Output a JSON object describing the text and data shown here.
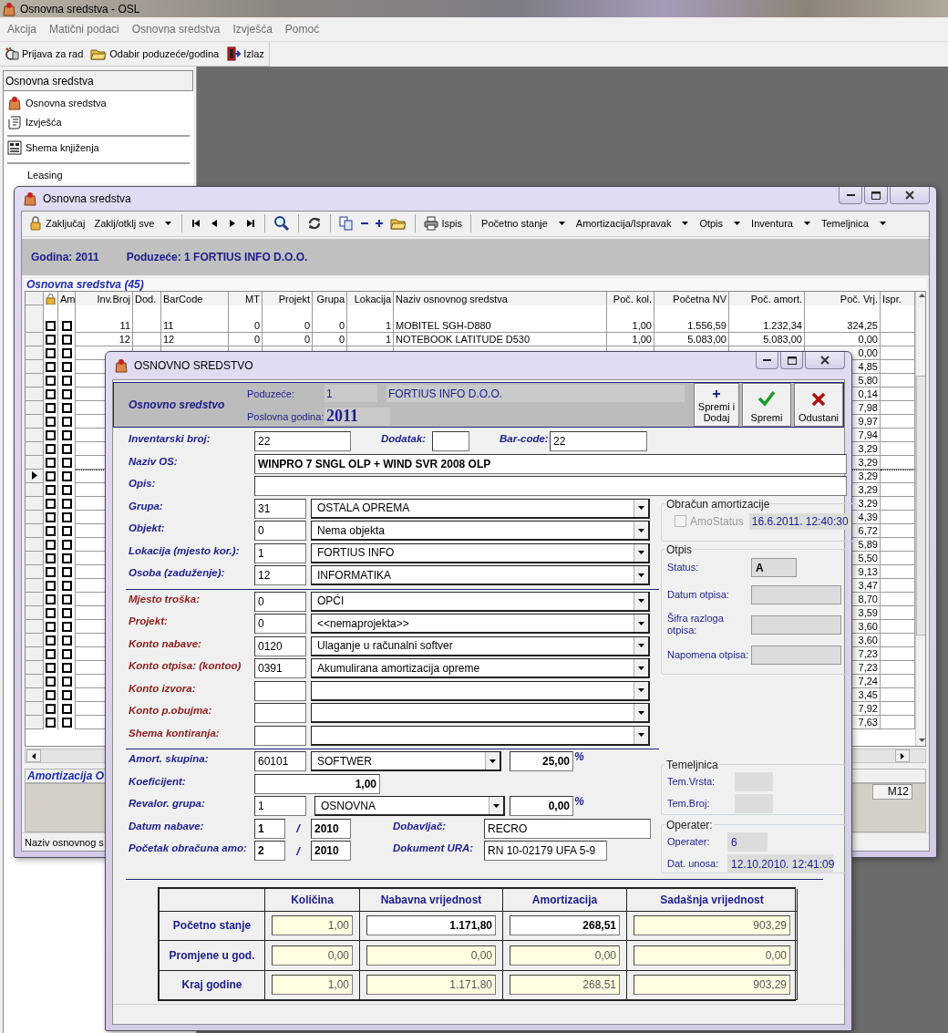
{
  "app": {
    "title": "Osnovna sredstva - OSL",
    "menu": [
      "Akcija",
      "Matični podaci",
      "Osnovna sredstva",
      "Izvješća",
      "Pomoć"
    ],
    "toolbar": [
      {
        "kind": "login",
        "label": "Prijava za rad"
      },
      {
        "kind": "folder",
        "label": "Odabir poduzeće/godina"
      },
      {
        "kind": "exit",
        "label": "Izlaz"
      }
    ]
  },
  "sidebar": {
    "header": "Osnovna sredstva",
    "items": [
      {
        "kind": "assets",
        "label": "Osnovna sredstva",
        "divider_above": false
      },
      {
        "kind": "reports",
        "label": "Izvješća",
        "divider_above": false
      },
      {
        "kind": "scheme",
        "label": "Shema knjiženja",
        "divider_above": true
      },
      {
        "kind": "plain",
        "label": "Leasing",
        "divider_above": true
      }
    ]
  },
  "list_window": {
    "title": "Osnovna sredstva",
    "toolbar": [
      {
        "kind": "lock",
        "label": "Zaključaj"
      },
      {
        "kind": "dropdown",
        "label": "Zaklj/otklj sve"
      },
      {
        "kind": "separator"
      },
      {
        "kind": "first"
      },
      {
        "kind": "prev"
      },
      {
        "kind": "next"
      },
      {
        "kind": "last"
      },
      {
        "kind": "separator"
      },
      {
        "kind": "search"
      },
      {
        "kind": "separator"
      },
      {
        "kind": "refresh"
      },
      {
        "kind": "separator"
      },
      {
        "kind": "copy"
      },
      {
        "kind": "minus"
      },
      {
        "kind": "plus"
      },
      {
        "kind": "folder"
      },
      {
        "kind": "separator"
      },
      {
        "kind": "print",
        "label": "Ispis"
      },
      {
        "kind": "separator"
      },
      {
        "kind": "dropdown",
        "label": "Početno stanje"
      },
      {
        "kind": "dropdown",
        "label": "Amortizacija/Ispravak"
      },
      {
        "kind": "dropdown",
        "label": "Otpis"
      },
      {
        "kind": "dropdown",
        "label": "Inventura"
      },
      {
        "kind": "dropdown",
        "label": "Temeljnica"
      }
    ],
    "year": "Godina: 2011",
    "company": "Poduzeće: 1 FORTIUS INFO D.O.O.",
    "grid": {
      "caption": "Osnovna sredstva (45)",
      "columns": [
        {
          "kind": "lock"
        },
        {
          "kind": "text",
          "label": "Am"
        },
        {
          "kind": "text",
          "label": "Inv.Broj"
        },
        {
          "kind": "text",
          "label": "Dod."
        },
        {
          "kind": "text",
          "label": "BarCode"
        },
        {
          "kind": "text",
          "label": "MT"
        },
        {
          "kind": "text",
          "label": "Projekt"
        },
        {
          "kind": "text",
          "label": "Grupa"
        },
        {
          "kind": "text",
          "label": "Lokacija"
        },
        {
          "kind": "text",
          "label": "Naziv osnovnog sredstva"
        },
        {
          "kind": "text",
          "label": "Poč. kol."
        },
        {
          "kind": "text",
          "label": "Početna NV"
        },
        {
          "kind": "text",
          "label": "Poč. amort."
        },
        {
          "kind": "text",
          "label": "Poč. Vrj."
        },
        {
          "kind": "text",
          "label": "Ispr."
        }
      ],
      "rows": [
        {
          "current": false,
          "locked": false,
          "am": false,
          "cells": {
            "inv": "11",
            "bar": "11",
            "mt": "0",
            "proj": "0",
            "grp": "0",
            "lok": "1",
            "naziv": "MOBITEL SGH-D880",
            "kol": "1,00",
            "nv": "1.556,59",
            "amort": "1.232,34",
            "vrj": "324,25"
          }
        },
        {
          "current": false,
          "locked": false,
          "am": false,
          "cells": {
            "inv": "12",
            "bar": "12",
            "mt": "0",
            "proj": "0",
            "grp": "0",
            "lok": "1",
            "naziv": "NOTEBOOK LATITUDE D530",
            "kol": "1,00",
            "nv": "5.083,00",
            "amort": "5.083,00",
            "vrj": "0,00"
          }
        },
        {
          "current": false,
          "locked": false,
          "am": false,
          "cells": {
            "vrj": "0,00"
          }
        },
        {
          "current": false,
          "locked": false,
          "am": false,
          "cells": {
            "vrj": "4,85"
          }
        },
        {
          "current": false,
          "locked": false,
          "am": false,
          "cells": {
            "vrj": "5,80"
          }
        },
        {
          "current": false,
          "locked": false,
          "am": false,
          "cells": {
            "vrj": "0,14"
          }
        },
        {
          "current": false,
          "locked": false,
          "am": false,
          "cells": {
            "vrj": "7,98"
          }
        },
        {
          "current": false,
          "locked": false,
          "am": false,
          "cells": {
            "vrj": "9,97"
          }
        },
        {
          "current": false,
          "locked": false,
          "am": false,
          "cells": {
            "vrj": "7,94"
          }
        },
        {
          "current": false,
          "locked": false,
          "am": false,
          "cells": {
            "vrj": "3,29"
          }
        },
        {
          "current": false,
          "locked": false,
          "am": false,
          "cells": {
            "vrj": "3,29"
          }
        },
        {
          "current": true,
          "locked": false,
          "am": false,
          "cells": {
            "vrj": "3,29"
          }
        },
        {
          "current": false,
          "locked": false,
          "am": false,
          "cells": {
            "vrj": "3,29"
          }
        },
        {
          "current": false,
          "locked": false,
          "am": false,
          "cells": {
            "vrj": "3,29"
          }
        },
        {
          "current": false,
          "locked": false,
          "am": false,
          "cells": {
            "vrj": "4,39"
          }
        },
        {
          "current": false,
          "locked": false,
          "am": false,
          "cells": {
            "vrj": "6,72"
          }
        },
        {
          "current": false,
          "locked": false,
          "am": false,
          "cells": {
            "vrj": "5,89"
          }
        },
        {
          "current": false,
          "locked": false,
          "am": false,
          "cells": {
            "vrj": "5,50"
          }
        },
        {
          "current": false,
          "locked": false,
          "am": false,
          "cells": {
            "vrj": "9,13"
          }
        },
        {
          "current": false,
          "locked": false,
          "am": false,
          "cells": {
            "vrj": "3,47"
          }
        },
        {
          "current": false,
          "locked": false,
          "am": false,
          "cells": {
            "vrj": "8,70"
          }
        },
        {
          "current": false,
          "locked": false,
          "am": false,
          "cells": {
            "vrj": "3,59"
          }
        },
        {
          "current": false,
          "locked": false,
          "am": false,
          "cells": {
            "vrj": "3,60"
          }
        },
        {
          "current": false,
          "locked": false,
          "am": false,
          "cells": {
            "vrj": "3,60"
          }
        },
        {
          "current": false,
          "locked": false,
          "am": false,
          "cells": {
            "vrj": "7,23"
          }
        },
        {
          "current": false,
          "locked": false,
          "am": false,
          "cells": {
            "vrj": "7,23"
          }
        },
        {
          "current": false,
          "locked": false,
          "am": false,
          "cells": {
            "vrj": "7,24"
          }
        },
        {
          "current": false,
          "locked": false,
          "am": false,
          "cells": {
            "vrj": "3,45"
          }
        },
        {
          "current": false,
          "locked": false,
          "am": false,
          "cells": {
            "vrj": "7,92"
          }
        },
        {
          "current": false,
          "locked": false,
          "am": false,
          "cells": {
            "vrj": "7,63"
          }
        }
      ]
    },
    "detail_caption": "Amortizacija O",
    "detail_cell": "M12",
    "status": "Naziv osnovnog s"
  },
  "dialog": {
    "title": "OSNOVNO SREDSTVO",
    "header": {
      "heading": "Osnovno sredstvo",
      "company_label": "Poduzeće:",
      "company_id": "1",
      "company_name": "FORTIUS INFO D.O.O.",
      "year_label": "Poslovna godina:",
      "year": "2011"
    },
    "buttons": [
      {
        "kind": "add",
        "label": "Spremi i Dodaj"
      },
      {
        "kind": "save",
        "label": "Spremi"
      },
      {
        "kind": "cancel",
        "label": "Odustani"
      }
    ],
    "inventory": {
      "label": "Inventarski broj:",
      "value": "22"
    },
    "addition": {
      "label": "Dodatak:"
    },
    "barcode": {
      "label": "Bar-code:",
      "value": "22"
    },
    "name": {
      "label": "Naziv OS:",
      "value": "WINPRO 7 SNGL OLP + WIND SVR 2008 OLP"
    },
    "description": {
      "label": "Opis:"
    },
    "assignment": [
      {
        "kind": "main",
        "label": "Grupa:",
        "code": "31",
        "name": "OSTALA OPREMA"
      },
      {
        "kind": "main",
        "label": "Objekt:",
        "code": "0",
        "name": "Nema objekta"
      },
      {
        "kind": "main",
        "label": "Lokacija (mjesto kor.):",
        "code": "1",
        "name": "FORTIUS INFO"
      },
      {
        "kind": "main",
        "label": "Osoba (zaduženje):",
        "code": "12",
        "name": "INFORMATIKA"
      }
    ],
    "accounts": [
      {
        "kind": "account",
        "label": "Mjesto troška:",
        "code": "0",
        "name": "OPĆI"
      },
      {
        "kind": "account",
        "label": "Projekt:",
        "code": "0",
        "name": "<<nemaprojekta>>"
      },
      {
        "kind": "account",
        "label": "Konto nabave:",
        "code": "0120",
        "name": "Ulaganje u računalni softver"
      },
      {
        "kind": "account",
        "label": "Konto otpisa: (kontoo)",
        "code": "0391",
        "name": "Akumulirana amortizacija opreme"
      },
      {
        "kind": "account",
        "label": "Konto izvora:"
      },
      {
        "kind": "account",
        "label": "Konto p.obujma:"
      },
      {
        "kind": "account",
        "label": "Shema kontiranja:"
      }
    ],
    "depreciation": {
      "group": {
        "label": "Amort. skupina:",
        "code": "60101",
        "name": "SOFTWER",
        "rate": "25,00",
        "unit": "%"
      },
      "coefficient": {
        "label": "Koeficijent:",
        "value": "1,00"
      },
      "revaluation": {
        "label": "Revalor. grupa:",
        "code": "1",
        "name": "OSNOVNA",
        "rate": "0,00",
        "unit": "%"
      },
      "purchase_date": {
        "label": "Datum nabave:",
        "month": "1",
        "separator": "/",
        "year": "2010"
      },
      "start_date": {
        "label": "Početak obračuna amo:",
        "month": "2",
        "separator": "/",
        "year": "2010"
      },
      "supplier": {
        "label": "Dobavljač:",
        "value": "RECRO"
      },
      "invoice": {
        "label": "Dokument URA:",
        "value": "RN 10-02179 UFA 5-9"
      }
    },
    "calculation": {
      "title": "Obračun amortizacije",
      "checkbox": {
        "label": "AmoStatus",
        "checked": false,
        "disabled": true
      },
      "timestamp": "16.6.2011. 12:40:30"
    },
    "write_off": {
      "title": "Otpis",
      "fields": [
        {
          "kind": "short",
          "label": "Status:",
          "value": "A"
        },
        {
          "kind": "long",
          "label": "Datum otpisa:"
        },
        {
          "kind": "long",
          "label": "Šifra razloga otpisa:"
        },
        {
          "kind": "long",
          "label": "Napomena otpisa:"
        }
      ]
    },
    "journal": {
      "title": "Temeljnica",
      "fields": [
        {
          "label": "Tem.Vrsta:"
        },
        {
          "label": "Tem.Broj:"
        }
      ]
    },
    "operator": {
      "title": "Operater:",
      "fields": [
        {
          "label": "Operater:",
          "value": "6"
        },
        {
          "label": "Dat. unosa:",
          "value": "12.10.2010. 12:41:09"
        }
      ]
    },
    "summary": {
      "columns": [
        "Količina",
        "Nabavna vrijednost",
        "Amortizacija",
        "Sadašnja vrijednost"
      ],
      "rows": [
        {
          "label": "Početno stanje",
          "cells": [
            {
              "value": "1,00",
              "editable": false
            },
            {
              "value": "1.171,80",
              "editable": true
            },
            {
              "value": "268,51",
              "editable": true
            },
            {
              "value": "903,29",
              "editable": false
            }
          ]
        },
        {
          "label": "Promjene u god.",
          "cells": [
            {
              "value": "0,00",
              "editable": false
            },
            {
              "value": "0,00",
              "editable": false
            },
            {
              "value": "0,00",
              "editable": false
            },
            {
              "value": "0,00",
              "editable": false
            }
          ]
        },
        {
          "label": "Kraj godine",
          "cells": [
            {
              "value": "1,00",
              "editable": false
            },
            {
              "value": "1.171,80",
              "editable": false
            },
            {
              "value": "268,51",
              "editable": false
            },
            {
              "value": "903,29",
              "editable": false
            }
          ]
        }
      ]
    }
  }
}
